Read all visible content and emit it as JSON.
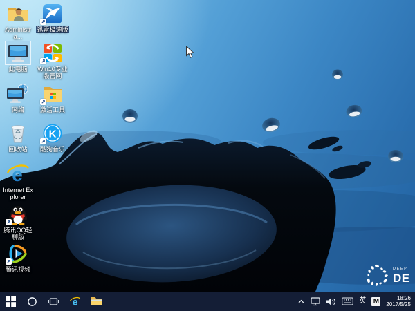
{
  "desktop": {
    "icons": [
      {
        "name": "administrator-folder",
        "label": "Administra..."
      },
      {
        "name": "xunlei-speed",
        "label": "迅雷极速版"
      },
      {
        "name": "this-pc",
        "label": "此电脑"
      },
      {
        "name": "win10-pro-site",
        "label": "Win10专业版官网"
      },
      {
        "name": "network",
        "label": "网络"
      },
      {
        "name": "activation-tools",
        "label": "激活工具"
      },
      {
        "name": "recycle-bin",
        "label": "回收站"
      },
      {
        "name": "kugou-music",
        "label": "酷狗音乐"
      },
      {
        "name": "internet-explorer",
        "label": "Internet Explorer"
      },
      {
        "name": "qq-light",
        "label": "腾讯QQ轻聊版"
      },
      {
        "name": "tencent-video",
        "label": "腾讯视频"
      }
    ],
    "glyphs": {
      "kugou": "K",
      "ie": "e"
    },
    "brand": {
      "small": "DEEP",
      "large": "DE"
    }
  },
  "taskbar": {
    "tray": {
      "language": "英",
      "ime": "M"
    },
    "clock": {
      "time": "18:26",
      "date": "2017/5/25"
    }
  },
  "colors": {
    "taskbar": "#141e36",
    "water_light": "#9cd4ef",
    "water_deep": "#205f9e",
    "splash_dark": "#040a14"
  }
}
